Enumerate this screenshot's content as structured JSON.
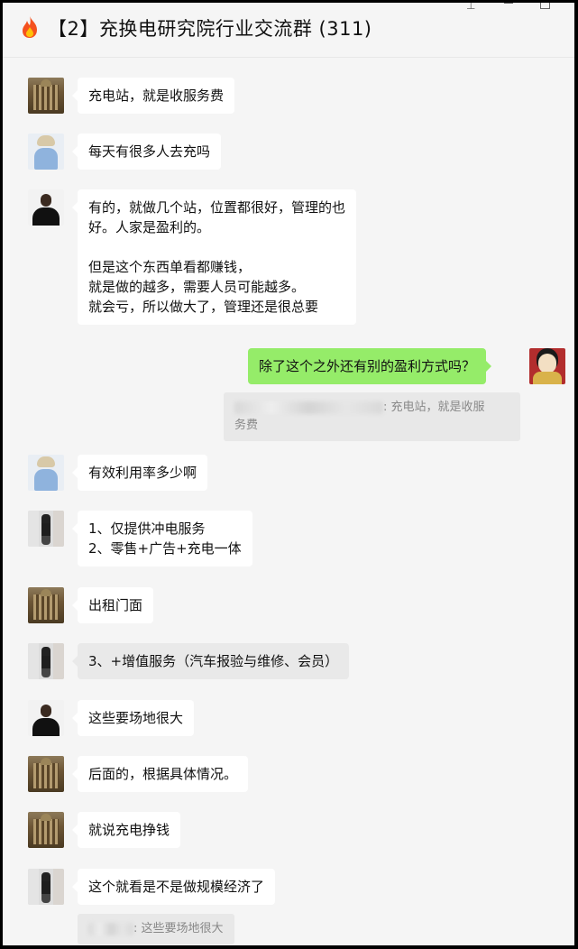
{
  "window": {
    "title": "【2】充换电研究院行业交流群 (311)",
    "title_icon": "fire-icon",
    "controls": [
      "pin-icon",
      "minimize-icon",
      "maximize-icon"
    ]
  },
  "messages": [
    {
      "side": "left",
      "avatar": "building",
      "text": "充电站，就是收服务费"
    },
    {
      "side": "left",
      "avatar": "girl",
      "text": "每天有很多人去充吗"
    },
    {
      "side": "left",
      "avatar": "man",
      "text": "有的，就做几个站，位置都很好，管理的也\n好。人家是盈利的。\n\n但是这个东西单看都赚钱，\n就是做的越多，需要人员可能越多。\n就会亏，所以做大了，管理还是很总要"
    },
    {
      "side": "right",
      "avatar": "queen",
      "text": "除了这个之外还有别的盈利方式吗？"
    },
    {
      "side": "quote",
      "text": ": 充电站，就是收服\n务费"
    },
    {
      "side": "left",
      "avatar": "girl",
      "text": "有效利用率多少啊"
    },
    {
      "side": "left",
      "avatar": "stand",
      "text": "1、仅提供冲电服务\n2、零售+广告+充电一体"
    },
    {
      "side": "left",
      "avatar": "building",
      "text": "出租门面"
    },
    {
      "side": "left",
      "avatar": "stand",
      "text": "3、+增值服务（汽车报验与维修、会员）"
    },
    {
      "side": "left",
      "avatar": "man",
      "text": "这些要场地很大"
    },
    {
      "side": "left",
      "avatar": "building",
      "text": "后面的，根据具体情况。"
    },
    {
      "side": "left",
      "avatar": "building",
      "text": "就说充电挣钱"
    },
    {
      "side": "left",
      "avatar": "stand",
      "text": "这个就看是不是做规模经济了"
    },
    {
      "side": "quote2",
      "text": ": 这些要场地很大"
    }
  ]
}
